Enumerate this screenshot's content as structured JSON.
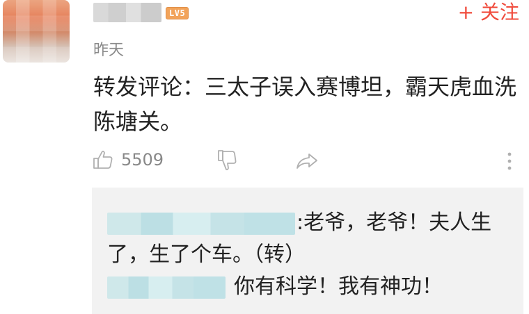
{
  "user": {
    "level_badge": "LV5",
    "follow_label": "+ 关注",
    "time": "昨天"
  },
  "comment": {
    "text": "转发评论：三太子误入赛博坦，霸天虎血洗陈塘关。"
  },
  "actions": {
    "like_count": "5509"
  },
  "replies": [
    {
      "separator": ":",
      "text": "老爷，老爷！夫人生了，生了个车。（转）"
    },
    {
      "text": "你有科学！我有神功！"
    }
  ],
  "colors": {
    "accent": "#f04b3c",
    "reply_background": "#f2f2f2",
    "muted_text": "#8a8a8a"
  }
}
